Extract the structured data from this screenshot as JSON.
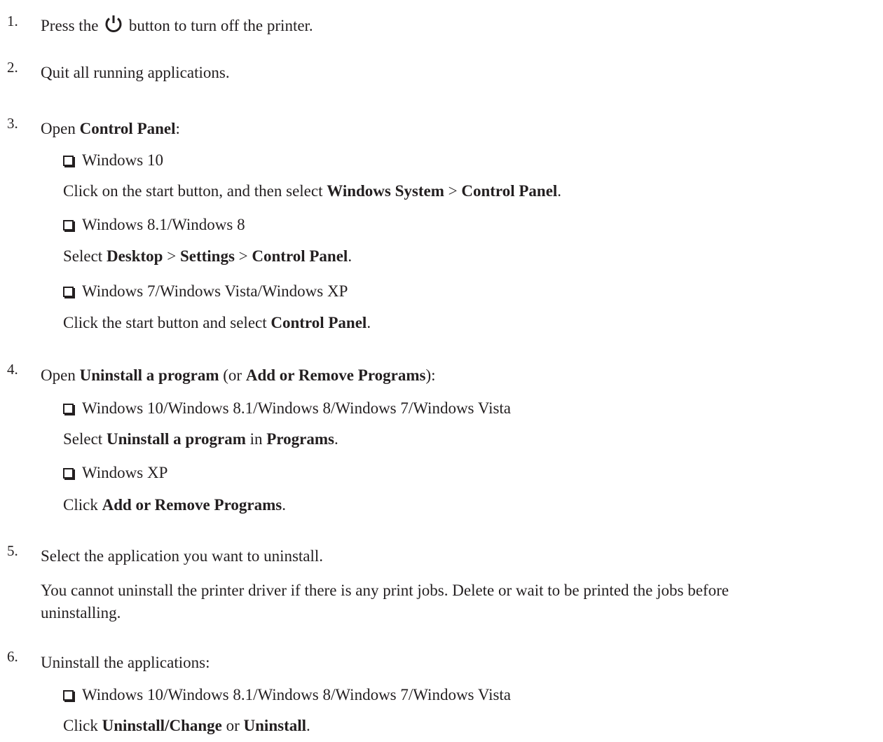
{
  "steps": [
    {
      "number": "1.",
      "lines": {
        "before_icon": "Press the",
        "after_icon": "button to turn off the printer."
      },
      "icon": "power-icon"
    },
    {
      "number": "2.",
      "text": "Quit all running applications."
    },
    {
      "number": "3.",
      "intro": {
        "t1": "Open ",
        "b1": "Control Panel",
        "t2": ":"
      },
      "items": [
        {
          "label": "Windows 10",
          "detail": {
            "t1": "Click on the start button, and then select ",
            "b1": "Windows System",
            "t2": " > ",
            "b2": "Control Panel",
            "t3": "."
          }
        },
        {
          "label": "Windows 8.1/Windows 8",
          "detail": {
            "t1": "Select ",
            "b1": "Desktop",
            "t2": " > ",
            "b2": "Settings",
            "t3": " > ",
            "b3": "Control Panel",
            "t4": "."
          }
        },
        {
          "label": "Windows 7/Windows Vista/Windows XP",
          "detail": {
            "t1": "Click the start button and select ",
            "b1": "Control Panel",
            "t2": "."
          }
        }
      ]
    },
    {
      "number": "4.",
      "intro": {
        "t1": "Open ",
        "b1": "Uninstall a program",
        "t2": " (or ",
        "b2": "Add or Remove Programs",
        "t3": "):"
      },
      "items": [
        {
          "label": "Windows 10/Windows 8.1/Windows 8/Windows 7/Windows Vista",
          "detail": {
            "t1": "Select ",
            "b1": "Uninstall a program",
            "t2": " in ",
            "b2": "Programs",
            "t3": "."
          }
        },
        {
          "label": "Windows XP",
          "detail": {
            "t1": "Click ",
            "b1": "Add or Remove Programs",
            "t2": "."
          }
        }
      ]
    },
    {
      "number": "5.",
      "text": "Select the application you want to uninstall.",
      "note_line1": "You cannot uninstall the printer driver if there is any print jobs. Delete or wait to be printed the jobs before",
      "note_line2": "uninstalling."
    },
    {
      "number": "6.",
      "text": "Uninstall the applications:",
      "items": [
        {
          "label": "Windows 10/Windows 8.1/Windows 8/Windows 7/Windows Vista",
          "detail": {
            "t1": "Click ",
            "b1": "Uninstall/Change",
            "t2": " or ",
            "b2": "Uninstall",
            "t3": "."
          }
        }
      ]
    }
  ]
}
